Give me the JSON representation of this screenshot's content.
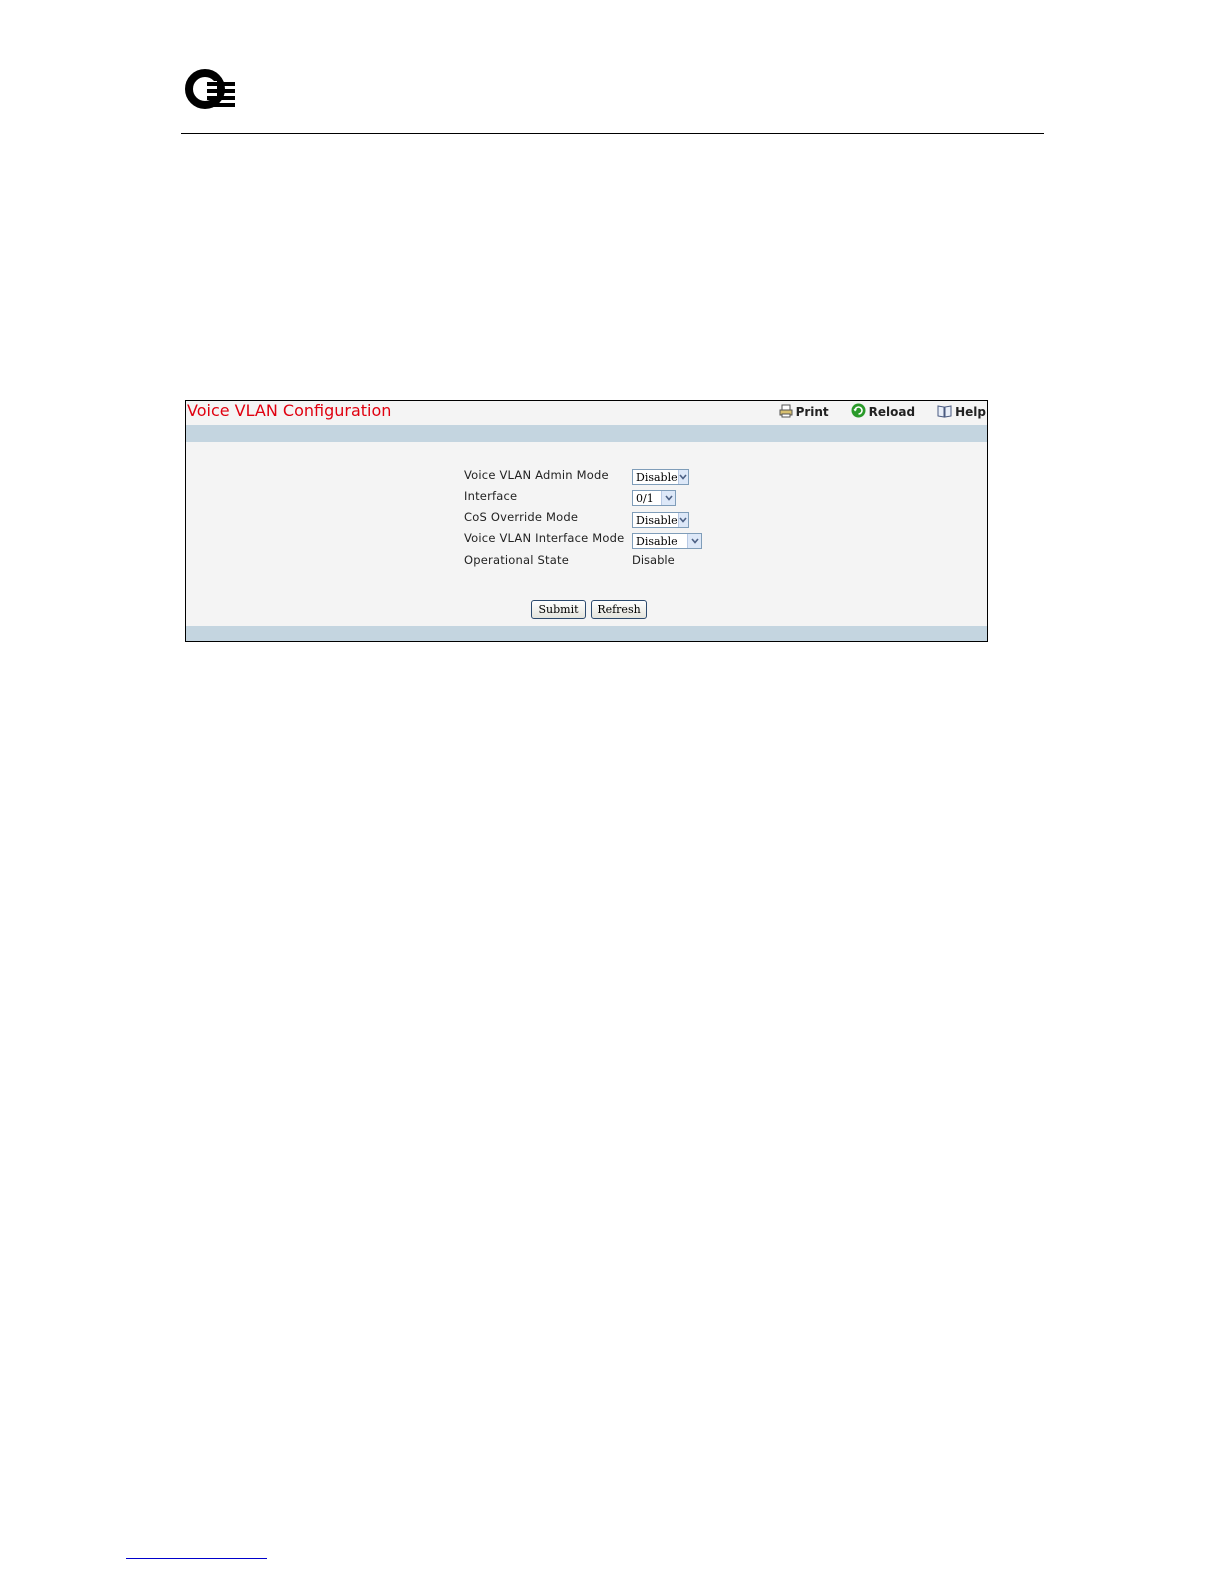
{
  "panel": {
    "title": "Voice VLAN Configuration",
    "toolbar": {
      "print": "Print",
      "reload": "Reload",
      "help": "Help"
    }
  },
  "form": {
    "admin_mode": {
      "label": "Voice VLAN Admin Mode",
      "value": "Disable"
    },
    "interface": {
      "label": "Interface",
      "value": "0/1"
    },
    "cos_override": {
      "label": "CoS Override Mode",
      "value": "Disable"
    },
    "interface_mode": {
      "label": "Voice VLAN Interface Mode",
      "value": "Disable"
    },
    "operational_state": {
      "label": "Operational State",
      "value": "Disable"
    }
  },
  "buttons": {
    "submit": "Submit",
    "refresh": "Refresh"
  },
  "colors": {
    "title": "#e0000f",
    "band": "#c4d5e0",
    "panel_bg": "#f4f4f4"
  }
}
